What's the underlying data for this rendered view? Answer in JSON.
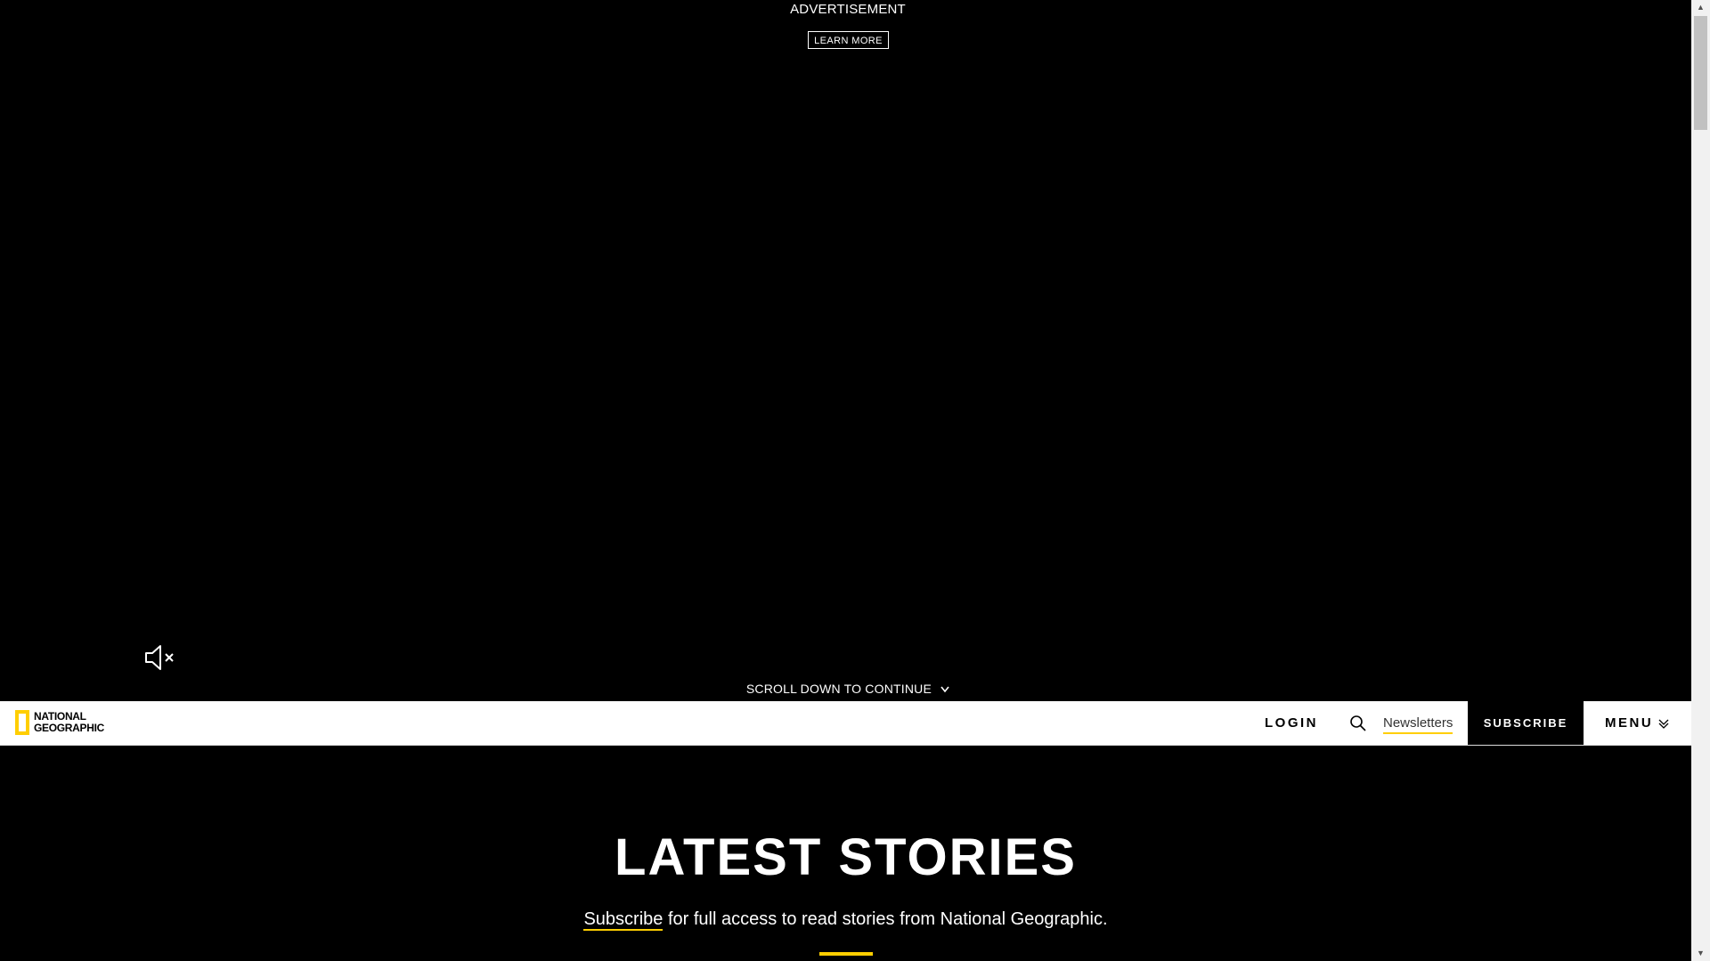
{
  "ad": {
    "label": "ADVERTISEMENT",
    "learn_more": "LEARN MORE",
    "mute_icon": "speaker-muted-icon",
    "scroll_text": "SCROLL DOWN TO CONTINUE",
    "scroll_icon": "chevron-down-icon"
  },
  "nav": {
    "logo_line1": "NATIONAL",
    "logo_line2": "GEOGRAPHIC",
    "login": "LOGIN",
    "search_icon": "search-icon",
    "newsletters": "Newsletters",
    "subscribe": "SUBSCRIBE",
    "menu": "MENU",
    "menu_icon": "chevron-down-icon"
  },
  "latest": {
    "title": "LATEST STORIES",
    "subscribe_link": "Subscribe",
    "subtitle_rest": " for full access to read stories from National Geographic."
  },
  "colors": {
    "brand_yellow": "#FFCE00",
    "background": "#000000",
    "nav_background": "#FFFFFF"
  }
}
